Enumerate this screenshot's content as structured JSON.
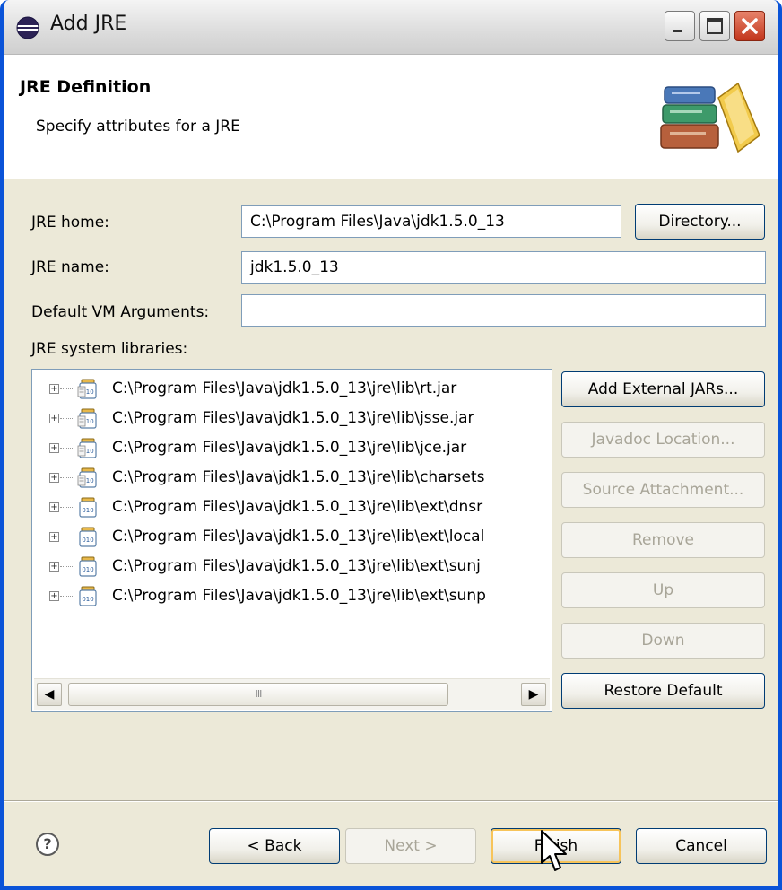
{
  "window": {
    "title": "Add JRE",
    "controls": {
      "minimize_icon": "minimize-icon",
      "maximize_icon": "maximize-icon",
      "close_icon": "close-icon"
    }
  },
  "banner": {
    "title": "JRE Definition",
    "subtitle": "Specify attributes for a JRE",
    "icon": "books-icon"
  },
  "form": {
    "jre_home_label": "JRE home:",
    "jre_home_value": "C:\\Program Files\\Java\\jdk1.5.0_13",
    "directory_button": "Directory...",
    "jre_name_label": "JRE name:",
    "jre_name_value": "jdk1.5.0_13",
    "vm_args_label": "Default VM Arguments:",
    "vm_args_value": "",
    "libraries_label": "JRE system libraries:"
  },
  "libraries": [
    {
      "path": "C:\\Program Files\\Java\\jdk1.5.0_13\\jre\\lib\\rt.jar",
      "icon": "jar-source-icon"
    },
    {
      "path": "C:\\Program Files\\Java\\jdk1.5.0_13\\jre\\lib\\jsse.jar",
      "icon": "jar-source-icon"
    },
    {
      "path": "C:\\Program Files\\Java\\jdk1.5.0_13\\jre\\lib\\jce.jar",
      "icon": "jar-source-icon"
    },
    {
      "path": "C:\\Program Files\\Java\\jdk1.5.0_13\\jre\\lib\\charsets",
      "icon": "jar-source-icon"
    },
    {
      "path": "C:\\Program Files\\Java\\jdk1.5.0_13\\jre\\lib\\ext\\dnsr",
      "icon": "jar-icon"
    },
    {
      "path": "C:\\Program Files\\Java\\jdk1.5.0_13\\jre\\lib\\ext\\local",
      "icon": "jar-icon"
    },
    {
      "path": "C:\\Program Files\\Java\\jdk1.5.0_13\\jre\\lib\\ext\\sunj",
      "icon": "jar-icon"
    },
    {
      "path": "C:\\Program Files\\Java\\jdk1.5.0_13\\jre\\lib\\ext\\sunp",
      "icon": "jar-icon"
    }
  ],
  "scrollbar": {
    "thumb_grip": "III"
  },
  "side_buttons": {
    "add_external_jars": "Add External JARs...",
    "javadoc_location": "Javadoc Location...",
    "source_attachment": "Source Attachment...",
    "remove": "Remove",
    "up": "Up",
    "down": "Down",
    "restore_default": "Restore Default"
  },
  "footer": {
    "help_icon": "help-icon",
    "help_glyph": "?",
    "back": "< Back",
    "next": "Next >",
    "finish": "Finish",
    "cancel": "Cancel"
  },
  "colors": {
    "title_bar_border": "#0a53d8",
    "dialog_background": "#ece9d8",
    "button_border": "#003c74",
    "disabled_text": "#a8a598",
    "close_button": "#c2351b"
  }
}
